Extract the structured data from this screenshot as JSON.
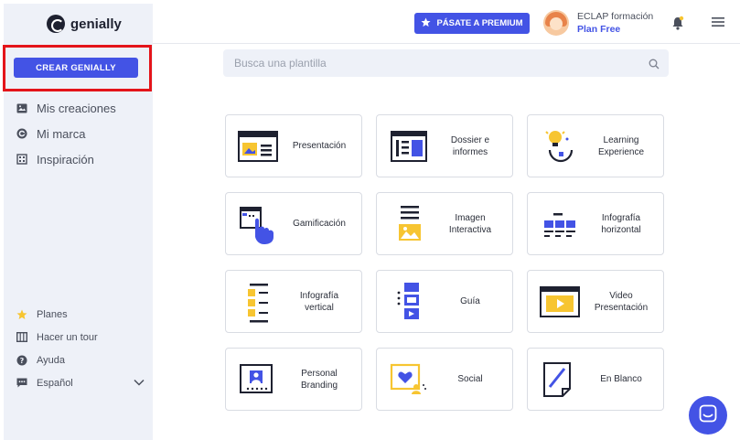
{
  "brand": {
    "name": "genially"
  },
  "sidebar": {
    "create_label": "CREAR GENIALLY",
    "nav": [
      {
        "label": "Mis creaciones",
        "icon": "image-icon"
      },
      {
        "label": "Mi marca",
        "icon": "brand-icon"
      },
      {
        "label": "Inspiración",
        "icon": "building-icon"
      }
    ],
    "bottom": [
      {
        "label": "Planes",
        "icon": "star-icon"
      },
      {
        "label": "Hacer un tour",
        "icon": "map-icon"
      },
      {
        "label": "Ayuda",
        "icon": "help-icon"
      },
      {
        "label": "Español",
        "icon": "chat-bubble-icon"
      }
    ]
  },
  "header": {
    "premium_label": "PÁSATE A PREMIUM",
    "user_name": "ECLAP formación",
    "user_plan": "Plan Free"
  },
  "search": {
    "placeholder": "Busca una plantilla",
    "value": ""
  },
  "templates": [
    {
      "label": "Presentación",
      "icon": "presentation-icon"
    },
    {
      "label": "Dossier e\ninformes",
      "icon": "dossier-icon"
    },
    {
      "label": "Learning\nExperience",
      "icon": "learning-icon"
    },
    {
      "label": "Gamificación",
      "icon": "gamification-icon"
    },
    {
      "label": "Imagen\nInteractiva",
      "icon": "interactive-image-icon"
    },
    {
      "label": "Infografía\nhorizontal",
      "icon": "horizontal-infographic-icon"
    },
    {
      "label": "Infografía\nvertical",
      "icon": "vertical-infographic-icon"
    },
    {
      "label": "Guía",
      "icon": "guide-icon"
    },
    {
      "label": "Video\nPresentación",
      "icon": "video-presentation-icon"
    },
    {
      "label": "Personal\nBranding",
      "icon": "personal-branding-icon"
    },
    {
      "label": "Social",
      "icon": "social-icon"
    },
    {
      "label": "En Blanco",
      "icon": "blank-icon"
    }
  ],
  "colors": {
    "accent": "#4353e5",
    "yellow": "#f7c531",
    "dark": "#1e2130",
    "highlight": "#e4141a"
  }
}
